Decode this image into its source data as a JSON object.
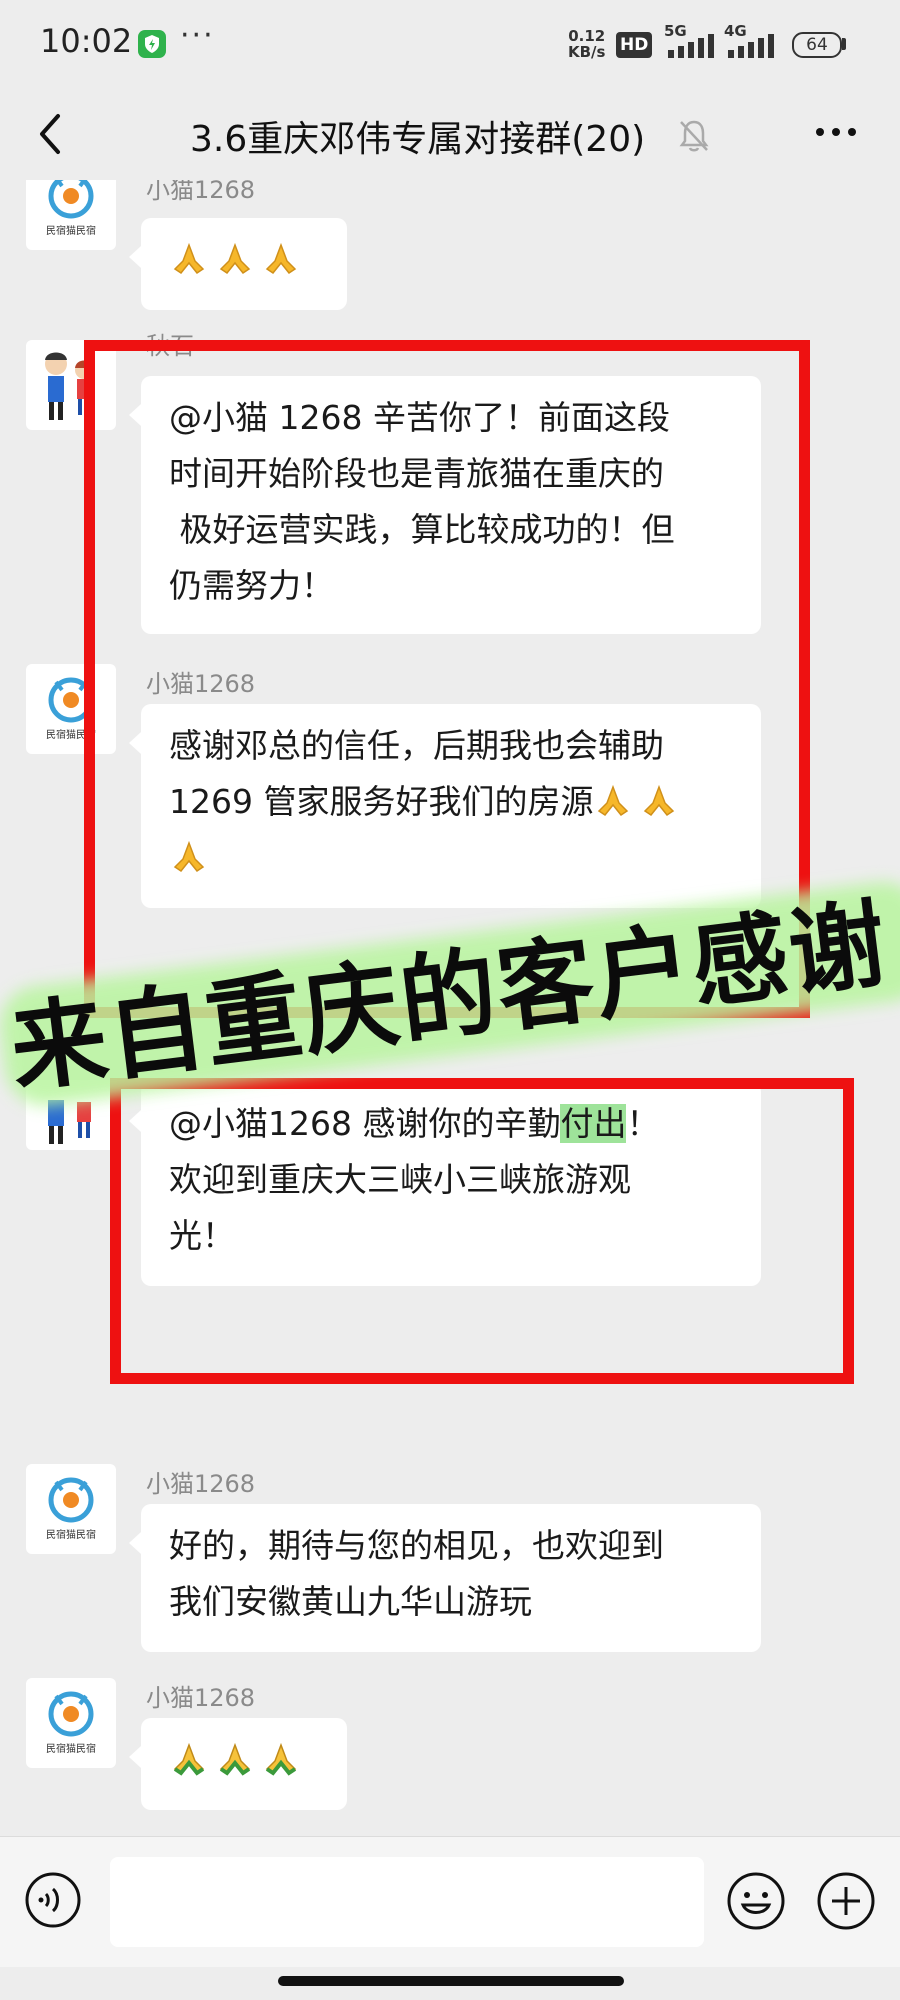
{
  "status_bar": {
    "time": "10:02",
    "more": "···",
    "speed_top": "0.12",
    "speed_bottom": "KB/s",
    "hd": "HD",
    "network_1": "5G",
    "network_2": "4G",
    "battery": "64"
  },
  "nav": {
    "title": "3.6重庆邓伟专属对接群(20)",
    "back_icon": "chevron-left-icon",
    "mute_icon": "bell-off-icon",
    "more_icon": "more-dots-icon"
  },
  "messages": [
    {
      "sender": "小猫1268",
      "emoji": "folded-hands-yellow",
      "emoji_count": 3
    },
    {
      "sender": "秋石",
      "lines": [
        "@小猫 1268  辛苦你了！前面这段",
        "时间开始阶段也是青旅猫在重庆的",
        " 极好运营实践，算比较成功的！但",
        "仍需努力！"
      ]
    },
    {
      "sender": "小猫1268",
      "lines": [
        "感谢邓总的信任，后期我也会辅助",
        "1269 管家服务好我们的房源"
      ],
      "emoji": "folded-hands-yellow"
    },
    {
      "lines_prefix": "@小猫1268  感谢你的辛勤",
      "highlight": "付出",
      "lines_suffix": "！",
      "lines": [
        "欢迎到重庆大三峡小三峡旅游观",
        "光！"
      ]
    },
    {
      "sender": "小猫1268",
      "lines": [
        "好的，期待与您的相见，也欢迎到",
        "我们安徽黄山九华山游玩"
      ]
    },
    {
      "sender": "小猫1268",
      "emoji": "folded-hands-green",
      "emoji_count": 3
    }
  ],
  "banner": {
    "text": "来自重庆的客户感谢"
  },
  "avatar_label": "民宿猫民宿",
  "colors": {
    "highlight": "#9ee39a",
    "frame": "#ee1111",
    "banner_glow": "#8cf16d"
  }
}
